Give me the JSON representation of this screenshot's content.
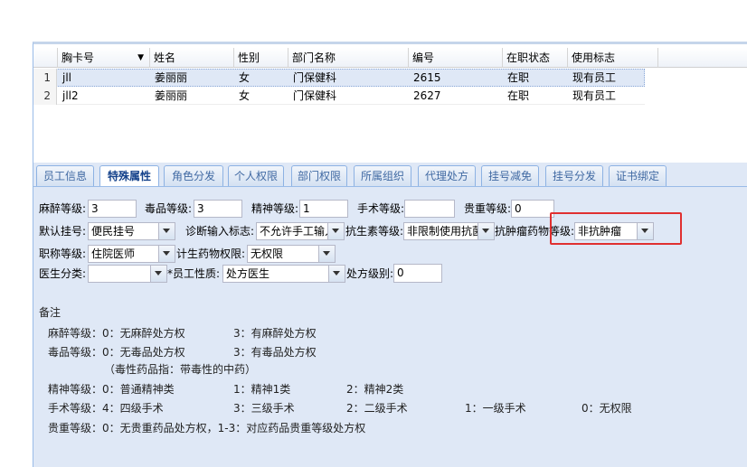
{
  "grid": {
    "columns": [
      "胸卡号",
      "姓名",
      "性别",
      "部门名称",
      "编号",
      "在职状态",
      "使用标志"
    ],
    "rows": [
      {
        "num": "1",
        "cells": [
          "jll",
          "姜丽丽",
          "女",
          "门保健科",
          "2615",
          "在职",
          "现有员工"
        ]
      },
      {
        "num": "2",
        "cells": [
          "jll2",
          "姜丽丽",
          "女",
          "门保健科",
          "2627",
          "在职",
          "现有员工"
        ]
      }
    ]
  },
  "tabs": [
    "员工信息",
    "特殊属性",
    "角色分发",
    "个人权限",
    "部门权限",
    "所属组织",
    "代理处方",
    "挂号减免",
    "挂号分发",
    "证书绑定"
  ],
  "active_tab": "特殊属性",
  "form": {
    "mazui_label": "麻醉等级:",
    "mazui_value": "3",
    "dupin_label": "毒品等级:",
    "dupin_value": "3",
    "jingshen_label": "精神等级:",
    "jingshen_value": "1",
    "shoushu_label": "手术等级:",
    "shoushu_value": "",
    "guizhong_label": "贵重等级:",
    "guizhong_value": "0",
    "guahao_label": "默认挂号:",
    "guahao_value": "便民挂号",
    "zhenduan_label": "诊断输入标志:",
    "zhenduan_value": "不允许手工输入",
    "kangsheng_label": "抗生素等级:",
    "kangsheng_value": "非限制使用抗菌",
    "kangzhong_label": "抗肿瘤药物等级:",
    "kangzhong_value": "非抗肿瘤",
    "zhicheng_label": "职称等级:",
    "zhicheng_value": "住院医师",
    "jisheng_label": "计生药物权限:",
    "jisheng_value": "无权限",
    "yisheng_label": "医生分类:",
    "yisheng_value": "",
    "yuangong_label": "*员工性质:",
    "yuangong_value": "处方医生",
    "chufang_label": "处方级别:",
    "chufang_value": "0"
  },
  "notes": {
    "title": "备注",
    "l1a": "麻醉等级：0：无麻醉处方权",
    "l1b": "3：有麻醉处方权",
    "l2a": "毒品等级：0：无毒品处方权",
    "l2b": "3：有毒品处方权",
    "l3": "（毒性药品指：带毒性的中药）",
    "l4a": "精神等级：0：普通精神类",
    "l4b": "1：精神1类",
    "l4c": "2：精神2类",
    "l5a": "手术等级：4：四级手术",
    "l5b": "3：三级手术",
    "l5c": "2：二级手术",
    "l5d": "1：一级手术",
    "l5e": "0：无权限",
    "l6": "贵重等级：0：无贵重药品处方权，1-3：对应药品贵重等级处方权"
  },
  "colors": {
    "highlight": "#e03030",
    "panel_bg": "#dfe8f6",
    "selected_row": "#dfe8f6"
  }
}
